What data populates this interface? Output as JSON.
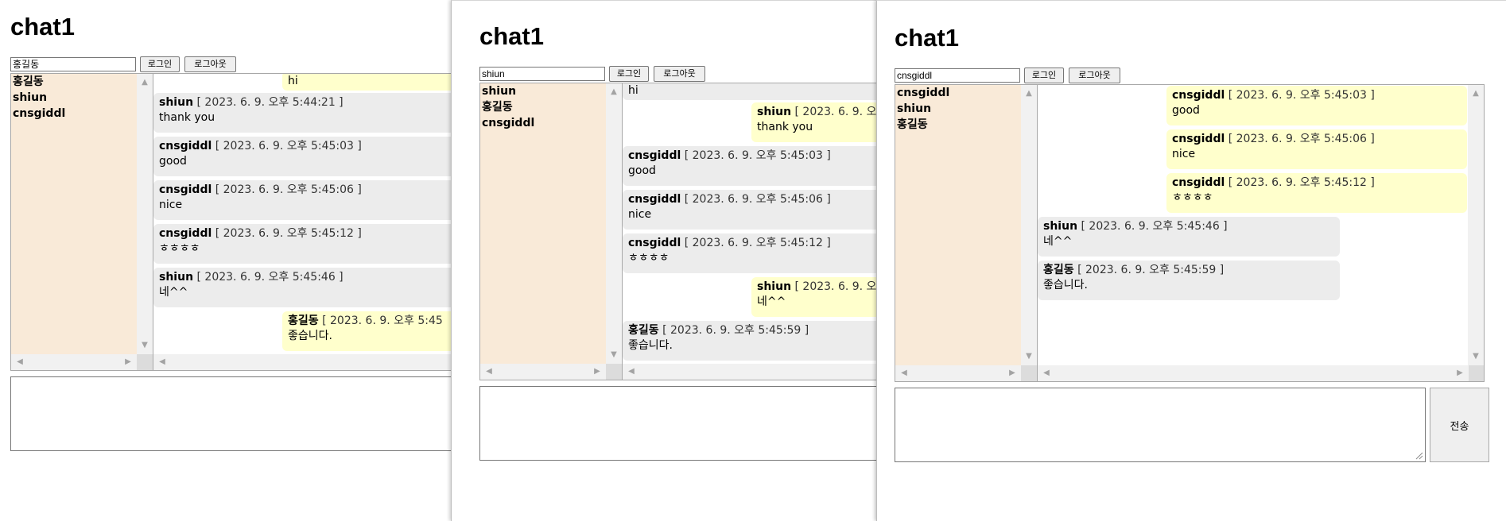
{
  "app_title": "chat1",
  "login_label": "로그인",
  "logout_label": "로그아웃",
  "send_label": "전송",
  "windows": [
    {
      "username": "홍길동",
      "users": [
        "홍길동",
        "shiun",
        "cnsgiddl"
      ],
      "messages": [
        {
          "name": "",
          "time": "",
          "text": "hi",
          "mine": true
        },
        {
          "name": "shiun",
          "time": "[ 2023. 6. 9. 오후 5:44:21 ]",
          "text": "thank you",
          "mine": false
        },
        {
          "name": "cnsgiddl",
          "time": "[ 2023. 6. 9. 오후 5:45:03 ]",
          "text": "good",
          "mine": false
        },
        {
          "name": "cnsgiddl",
          "time": "[ 2023. 6. 9. 오후 5:45:06 ]",
          "text": "nice",
          "mine": false
        },
        {
          "name": "cnsgiddl",
          "time": "[ 2023. 6. 9. 오후 5:45:12 ]",
          "text": "ㅎㅎㅎㅎ",
          "mine": false
        },
        {
          "name": "shiun",
          "time": "[ 2023. 6. 9. 오후 5:45:46 ]",
          "text": "네^^",
          "mine": false
        },
        {
          "name": "홍길동",
          "time": "[ 2023. 6. 9. 오후 5:45",
          "text": "좋습니다.",
          "mine": true
        }
      ]
    },
    {
      "username": "shiun",
      "users": [
        "shiun",
        "홍길동",
        "cnsgiddl"
      ],
      "messages": [
        {
          "name": "",
          "time": "",
          "text": "hi",
          "mine": false
        },
        {
          "name": "shiun",
          "time": "[ 2023. 6. 9. 오",
          "text": "thank you",
          "mine": true
        },
        {
          "name": "cnsgiddl",
          "time": "[ 2023. 6. 9. 오후 5:45:03 ]",
          "text": "good",
          "mine": false
        },
        {
          "name": "cnsgiddl",
          "time": "[ 2023. 6. 9. 오후 5:45:06 ]",
          "text": "nice",
          "mine": false
        },
        {
          "name": "cnsgiddl",
          "time": "[ 2023. 6. 9. 오후 5:45:12 ]",
          "text": "ㅎㅎㅎㅎ",
          "mine": false
        },
        {
          "name": "shiun",
          "time": "[ 2023. 6. 9. 오",
          "text": "네^^",
          "mine": true
        },
        {
          "name": "홍길동",
          "time": "[ 2023. 6. 9. 오후 5:45:59 ]",
          "text": "좋습니다.",
          "mine": false
        }
      ]
    },
    {
      "username": "cnsgiddl",
      "users": [
        "cnsgiddl",
        "shiun",
        "홍길동"
      ],
      "messages": [
        {
          "name": "cnsgiddl",
          "time": "[ 2023. 6. 9. 오후 5:45:03 ]",
          "text": "good",
          "mine": true
        },
        {
          "name": "cnsgiddl",
          "time": "[ 2023. 6. 9. 오후 5:45:06 ]",
          "text": "nice",
          "mine": true
        },
        {
          "name": "cnsgiddl",
          "time": "[ 2023. 6. 9. 오후 5:45:12 ]",
          "text": "ㅎㅎㅎㅎ",
          "mine": true
        },
        {
          "name": "shiun",
          "time": "[ 2023. 6. 9. 오후 5:45:46 ]",
          "text": "네^^",
          "mine": false
        },
        {
          "name": "홍길동",
          "time": "[ 2023. 6. 9. 오후 5:45:59 ]",
          "text": "좋습니다.",
          "mine": false
        }
      ]
    }
  ]
}
